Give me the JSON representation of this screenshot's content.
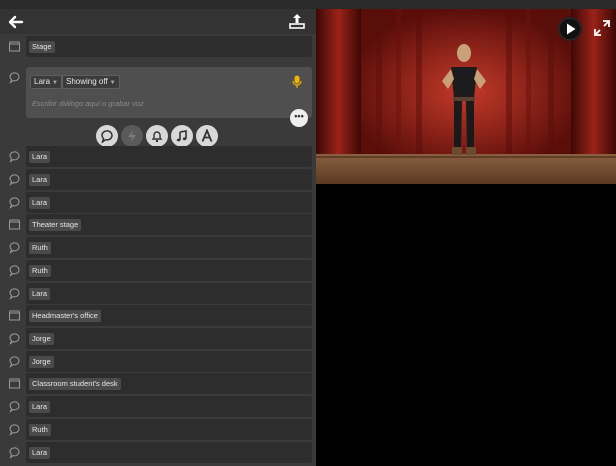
{
  "scene_list": [
    {
      "type": "scene",
      "label": "Stage"
    },
    {
      "type": "scene",
      "label": "Theater stage"
    },
    {
      "type": "scene",
      "label": "Headmaster's office"
    },
    {
      "type": "scene",
      "label": "Classroom student's desk"
    }
  ],
  "editor": {
    "character": "Lara",
    "animation": "Showing off",
    "placeholder": "Escribir diálogo aquí o grabar voz"
  },
  "dialog_rows": [
    {
      "label": "Lara"
    },
    {
      "label": "Lara"
    },
    {
      "label": "Lara"
    },
    {
      "label": "Ruth"
    },
    {
      "label": "Ruth"
    },
    {
      "label": "Lara"
    },
    {
      "label": "Jorge"
    },
    {
      "label": "Jorge"
    },
    {
      "label": "Lara"
    },
    {
      "label": "Ruth"
    },
    {
      "label": "Lara"
    }
  ],
  "more_label": "•••",
  "colors": {
    "accent_mic": "#f0b400",
    "panel_bg": "#3a3a3a",
    "row_bg": "#2d2d2d",
    "label_bg": "#4a4a4a",
    "curtain": "#8b1a14",
    "stage_floor": "#6b4a2e"
  },
  "icons": [
    "back-arrow-icon",
    "share-icon",
    "speech-bubble-icon",
    "clapperboard-icon",
    "mic-icon",
    "bolt-icon",
    "bell-icon",
    "music-icon",
    "text-icon",
    "play-icon",
    "expand-icon"
  ]
}
